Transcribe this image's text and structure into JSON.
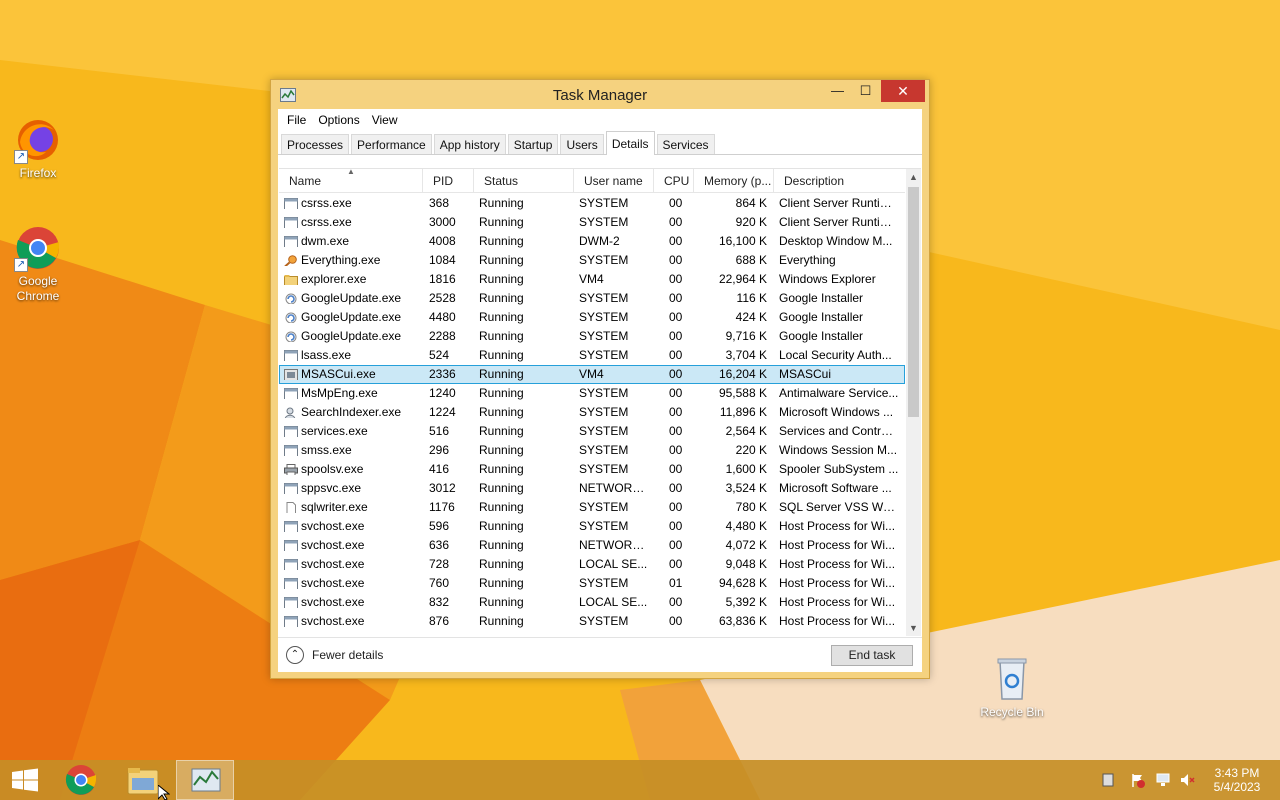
{
  "desktop": {
    "icons": [
      {
        "label": "Firefox"
      },
      {
        "label": "Google\nChrome"
      },
      {
        "label": "Recycle Bin"
      }
    ]
  },
  "window": {
    "title": "Task Manager",
    "minimize": "—",
    "maximize": "☐",
    "close": "✕"
  },
  "menu": [
    "File",
    "Options",
    "View"
  ],
  "tabs": [
    "Processes",
    "Performance",
    "App history",
    "Startup",
    "Users",
    "Details",
    "Services"
  ],
  "active_tab": "Details",
  "columns": [
    "Name",
    "PID",
    "Status",
    "User name",
    "CPU",
    "Memory (p...",
    "Description"
  ],
  "rows": [
    {
      "name": "csrss.exe",
      "pid": "368",
      "status": "Running",
      "user": "SYSTEM",
      "cpu": "00",
      "mem": "864 K",
      "desc": "Client Server Runtim...",
      "icon": "window-icon"
    },
    {
      "name": "csrss.exe",
      "pid": "3000",
      "status": "Running",
      "user": "SYSTEM",
      "cpu": "00",
      "mem": "920 K",
      "desc": "Client Server Runtim...",
      "icon": "window-icon"
    },
    {
      "name": "dwm.exe",
      "pid": "4008",
      "status": "Running",
      "user": "DWM-2",
      "cpu": "00",
      "mem": "16,100 K",
      "desc": "Desktop Window M...",
      "icon": "window-icon"
    },
    {
      "name": "Everything.exe",
      "pid": "1084",
      "status": "Running",
      "user": "SYSTEM",
      "cpu": "00",
      "mem": "688 K",
      "desc": "Everything",
      "icon": "magnifier-icon"
    },
    {
      "name": "explorer.exe",
      "pid": "1816",
      "status": "Running",
      "user": "VM4",
      "cpu": "00",
      "mem": "22,964 K",
      "desc": "Windows Explorer",
      "icon": "folder-icon"
    },
    {
      "name": "GoogleUpdate.exe",
      "pid": "2528",
      "status": "Running",
      "user": "SYSTEM",
      "cpu": "00",
      "mem": "116 K",
      "desc": "Google Installer",
      "icon": "google-update-icon"
    },
    {
      "name": "GoogleUpdate.exe",
      "pid": "4480",
      "status": "Running",
      "user": "SYSTEM",
      "cpu": "00",
      "mem": "424 K",
      "desc": "Google Installer",
      "icon": "google-update-icon"
    },
    {
      "name": "GoogleUpdate.exe",
      "pid": "2288",
      "status": "Running",
      "user": "SYSTEM",
      "cpu": "00",
      "mem": "9,716 K",
      "desc": "Google Installer",
      "icon": "google-update-icon"
    },
    {
      "name": "lsass.exe",
      "pid": "524",
      "status": "Running",
      "user": "SYSTEM",
      "cpu": "00",
      "mem": "3,704 K",
      "desc": "Local Security Auth...",
      "icon": "window-icon"
    },
    {
      "name": "MSASCui.exe",
      "pid": "2336",
      "status": "Running",
      "user": "VM4",
      "cpu": "00",
      "mem": "16,204 K",
      "desc": "MSASCui",
      "icon": "defender-icon",
      "selected": true
    },
    {
      "name": "MsMpEng.exe",
      "pid": "1240",
      "status": "Running",
      "user": "SYSTEM",
      "cpu": "00",
      "mem": "95,588 K",
      "desc": "Antimalware Service...",
      "icon": "window-icon"
    },
    {
      "name": "SearchIndexer.exe",
      "pid": "1224",
      "status": "Running",
      "user": "SYSTEM",
      "cpu": "00",
      "mem": "11,896 K",
      "desc": "Microsoft Windows ...",
      "icon": "search-indexer-icon"
    },
    {
      "name": "services.exe",
      "pid": "516",
      "status": "Running",
      "user": "SYSTEM",
      "cpu": "00",
      "mem": "2,564 K",
      "desc": "Services and Control...",
      "icon": "window-icon"
    },
    {
      "name": "smss.exe",
      "pid": "296",
      "status": "Running",
      "user": "SYSTEM",
      "cpu": "00",
      "mem": "220 K",
      "desc": "Windows Session M...",
      "icon": "window-icon"
    },
    {
      "name": "spoolsv.exe",
      "pid": "416",
      "status": "Running",
      "user": "SYSTEM",
      "cpu": "00",
      "mem": "1,600 K",
      "desc": "Spooler SubSystem ...",
      "icon": "printer-icon"
    },
    {
      "name": "sppsvc.exe",
      "pid": "3012",
      "status": "Running",
      "user": "NETWORK...",
      "cpu": "00",
      "mem": "3,524 K",
      "desc": "Microsoft Software ...",
      "icon": "window-icon"
    },
    {
      "name": "sqlwriter.exe",
      "pid": "1176",
      "status": "Running",
      "user": "SYSTEM",
      "cpu": "00",
      "mem": "780 K",
      "desc": "SQL Server VSS Writ...",
      "icon": "blank-file-icon"
    },
    {
      "name": "svchost.exe",
      "pid": "596",
      "status": "Running",
      "user": "SYSTEM",
      "cpu": "00",
      "mem": "4,480 K",
      "desc": "Host Process for Wi...",
      "icon": "window-icon"
    },
    {
      "name": "svchost.exe",
      "pid": "636",
      "status": "Running",
      "user": "NETWORK...",
      "cpu": "00",
      "mem": "4,072 K",
      "desc": "Host Process for Wi...",
      "icon": "window-icon"
    },
    {
      "name": "svchost.exe",
      "pid": "728",
      "status": "Running",
      "user": "LOCAL SE...",
      "cpu": "00",
      "mem": "9,048 K",
      "desc": "Host Process for Wi...",
      "icon": "window-icon"
    },
    {
      "name": "svchost.exe",
      "pid": "760",
      "status": "Running",
      "user": "SYSTEM",
      "cpu": "01",
      "mem": "94,628 K",
      "desc": "Host Process for Wi...",
      "icon": "window-icon"
    },
    {
      "name": "svchost.exe",
      "pid": "832",
      "status": "Running",
      "user": "LOCAL SE...",
      "cpu": "00",
      "mem": "5,392 K",
      "desc": "Host Process for Wi...",
      "icon": "window-icon"
    },
    {
      "name": "svchost.exe",
      "pid": "876",
      "status": "Running",
      "user": "SYSTEM",
      "cpu": "00",
      "mem": "63,836 K",
      "desc": "Host Process for Wi...",
      "icon": "window-icon"
    }
  ],
  "footer": {
    "fewer_details": "Fewer details",
    "end_task": "End task"
  },
  "taskbar": {
    "time": "3:43 PM",
    "date": "5/4/2023"
  },
  "colors": {
    "wallpaper": "#f7b318",
    "window_frame": "#f5d27f",
    "close_button": "#c7372f",
    "selection": "#cbe8f6",
    "selection_border": "#26a0da"
  }
}
